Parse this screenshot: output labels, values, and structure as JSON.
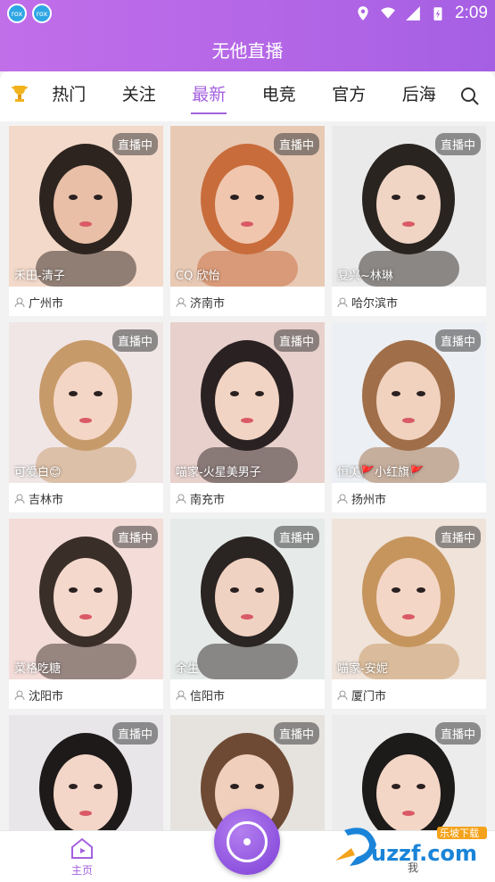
{
  "status": {
    "time": "2:09"
  },
  "header": {
    "title": "无他直播"
  },
  "tabs": [
    {
      "label": "热门"
    },
    {
      "label": "关注"
    },
    {
      "label": "最新"
    },
    {
      "label": "电竞"
    },
    {
      "label": "官方"
    },
    {
      "label": "后海"
    }
  ],
  "live_badge": "直播中",
  "cards": [
    {
      "nick": "禾田-清子",
      "city": "广州市"
    },
    {
      "nick": "CQ 欣怡",
      "city": "济南市"
    },
    {
      "nick": "复兴~林琳",
      "city": "哈尔滨市"
    },
    {
      "nick": "可爱白😊",
      "city": "吉林市"
    },
    {
      "nick": "喵家-火星美男子",
      "city": "南充市"
    },
    {
      "nick": "恒美🚩小红旗🚩",
      "city": "扬州市"
    },
    {
      "nick": "菜格吃糖",
      "city": "沈阳市"
    },
    {
      "nick": "余生",
      "city": "信阳市"
    },
    {
      "nick": "喵家-安妮",
      "city": "厦门市"
    },
    {
      "nick": "",
      "city": ""
    },
    {
      "nick": "",
      "city": ""
    },
    {
      "nick": "",
      "city": ""
    }
  ],
  "nav": {
    "home": "主页",
    "me": "我"
  },
  "watermark": {
    "top": "乐坡下载",
    "brand": "uzzf.com"
  },
  "colors": {
    "accent": "#a461df",
    "header": "#b266e6"
  }
}
